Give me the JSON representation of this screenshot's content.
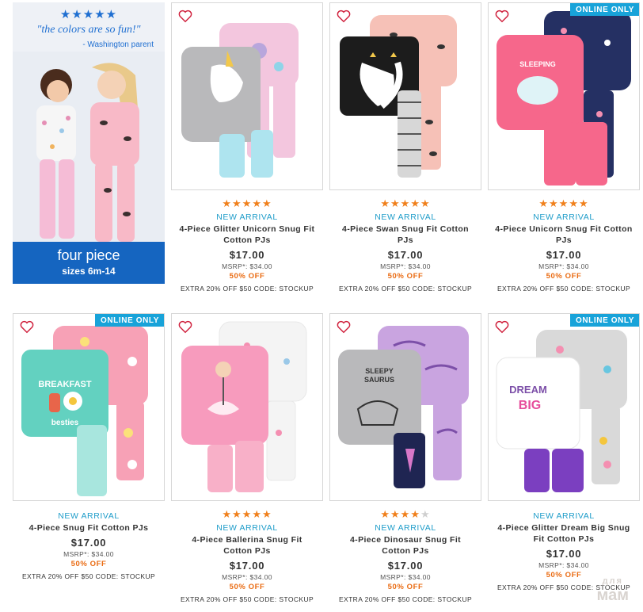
{
  "promo": {
    "rating_stars": "★★★★★",
    "quote": "\"the colors are so fun!\"",
    "attribution": "- Washington parent",
    "title": "four piece",
    "subtitle": "sizes 6m-14"
  },
  "badges": {
    "online_only": "ONLINE ONLY"
  },
  "colors": {
    "brand_blue": "#1565c0",
    "badge_blue": "#18a3d9",
    "star_orange": "#f0801c",
    "discount_orange": "#ea6b12"
  },
  "products": [
    {
      "stars": "★★★★★",
      "stars_off": "",
      "tag": "NEW ARRIVAL",
      "name": "4-Piece Glitter Unicorn Snug Fit Cotton PJs",
      "price": "$17.00",
      "msrp": "MSRP*: $34.00",
      "discount": "50% OFF",
      "extra": "EXTRA 20% OFF $50 CODE: STOCKUP",
      "badge": ""
    },
    {
      "stars": "★★★★★",
      "stars_off": "",
      "tag": "NEW ARRIVAL",
      "name": "4-Piece Swan Snug Fit Cotton PJs",
      "price": "$17.00",
      "msrp": "MSRP*: $34.00",
      "discount": "50% OFF",
      "extra": "EXTRA 20% OFF $50 CODE: STOCKUP",
      "badge": ""
    },
    {
      "stars": "★★★★★",
      "stars_off": "",
      "tag": "NEW ARRIVAL",
      "name": "4-Piece Unicorn Snug Fit Cotton PJs",
      "price": "$17.00",
      "msrp": "MSRP*: $34.00",
      "discount": "50% OFF",
      "extra": "EXTRA 20% OFF $50 CODE: STOCKUP",
      "badge": "ONLINE ONLY"
    },
    {
      "stars": "",
      "stars_off": "",
      "tag": "NEW ARRIVAL",
      "name": "4-Piece Snug Fit Cotton PJs",
      "price": "$17.00",
      "msrp": "MSRP*: $34.00",
      "discount": "50% OFF",
      "extra": "EXTRA 20% OFF $50 CODE: STOCKUP",
      "badge": "ONLINE ONLY"
    },
    {
      "stars": "★★★★★",
      "stars_off": "",
      "tag": "NEW ARRIVAL",
      "name": "4-Piece Ballerina Snug Fit Cotton PJs",
      "price": "$17.00",
      "msrp": "MSRP*: $34.00",
      "discount": "50% OFF",
      "extra": "EXTRA 20% OFF $50 CODE: STOCKUP",
      "badge": ""
    },
    {
      "stars": "★★★★",
      "stars_off": "★",
      "tag": "NEW ARRIVAL",
      "name": "4-Piece Dinosaur Snug Fit Cotton PJs",
      "price": "$17.00",
      "msrp": "MSRP*: $34.00",
      "discount": "50% OFF",
      "extra": "EXTRA 20% OFF $50 CODE: STOCKUP",
      "badge": ""
    },
    {
      "stars": "",
      "stars_off": "",
      "tag": "NEW ARRIVAL",
      "name": "4-Piece Glitter Dream Big Snug Fit Cotton PJs",
      "price": "$17.00",
      "msrp": "MSRP*: $34.00",
      "discount": "50% OFF",
      "extra": "EXTRA 20% OFF $50 CODE: STOCKUP",
      "badge": "ONLINE ONLY"
    }
  ],
  "watermark": {
    "top": "для",
    "bottom": "мам"
  }
}
